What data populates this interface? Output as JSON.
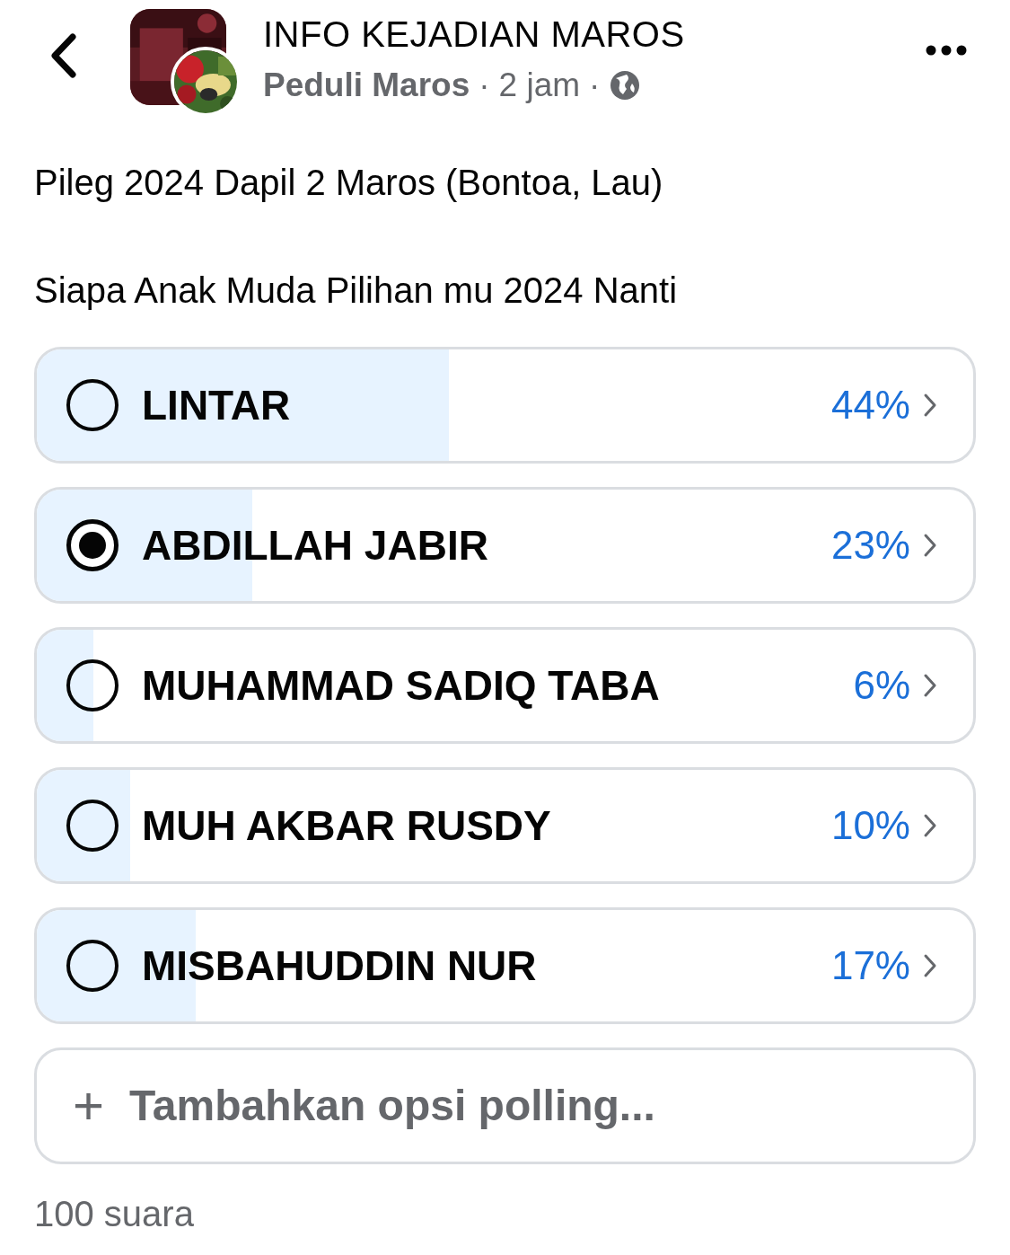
{
  "header": {
    "title": "INFO KEJADIAN MAROS",
    "author": "Peduli Maros",
    "separator_1": "·",
    "time": "2 jam",
    "separator_2": "·"
  },
  "post": {
    "lines": [
      "Pileg 2024 Dapil 2 Maros (Bontoa, Lau)",
      "Siapa Anak Muda Pilihan mu 2024 Nanti"
    ]
  },
  "poll": {
    "options": [
      {
        "label": "LINTAR",
        "percent": "44%",
        "level": 0.44,
        "selected": false
      },
      {
        "label": "ABDILLAH JABIR",
        "percent": "23%",
        "level": 0.23,
        "selected": true
      },
      {
        "label": "MUHAMMAD SADIQ TABA",
        "percent": "6%",
        "level": 0.06,
        "selected": false
      },
      {
        "label": "MUH AKBAR RUSDY",
        "percent": "10%",
        "level": 0.1,
        "selected": false
      },
      {
        "label": "MISBAHUDDIN NUR",
        "percent": "17%",
        "level": 0.17,
        "selected": false
      }
    ],
    "add_option": {
      "plus": "+",
      "placeholder": "Tambahkan opsi polling..."
    },
    "total": "100 suara"
  }
}
